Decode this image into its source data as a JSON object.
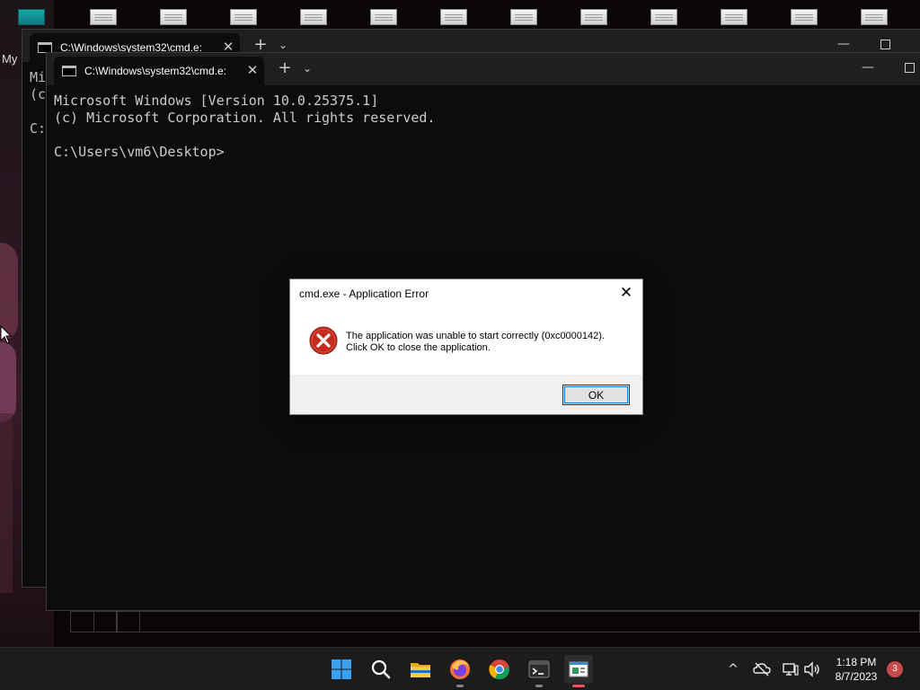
{
  "desktop": {
    "label_partial": "My"
  },
  "back_window": {
    "tab_title": "C:\\Windows\\system32\\cmd.e:",
    "console_lines": [
      "Mi",
      "(c",
      "",
      "C:"
    ],
    "close_glyph": "✕",
    "new_tab_glyph": "+",
    "dropdown_glyph": "⌄",
    "minimize_glyph": "—"
  },
  "front_window": {
    "tab_title": "C:\\Windows\\system32\\cmd.e:",
    "console_text": "Microsoft Windows [Version 10.0.25375.1]\n(c) Microsoft Corporation. All rights reserved.\n\nC:\\Users\\vm6\\Desktop>",
    "close_glyph": "✕",
    "new_tab_glyph": "+",
    "dropdown_glyph": "⌄",
    "minimize_glyph": "—"
  },
  "dialog": {
    "title": "cmd.exe - Application Error",
    "close_glyph": "✕",
    "message_line1": "The application was unable to start correctly (0xc0000142).",
    "message_line2": "Click OK to close the application.",
    "ok_label": "OK",
    "error_color": "#c42b1c"
  },
  "taskbar": {
    "items": [
      {
        "name": "start-button",
        "icon": "windows-logo-icon"
      },
      {
        "name": "search-button",
        "icon": "search-icon"
      },
      {
        "name": "file-explorer",
        "icon": "folder-icon"
      },
      {
        "name": "firefox",
        "icon": "firefox-icon"
      },
      {
        "name": "chrome",
        "icon": "chrome-icon"
      },
      {
        "name": "terminal",
        "icon": "terminal-icon"
      },
      {
        "name": "cmd-error-window",
        "icon": "app-window-icon",
        "active": true
      }
    ],
    "tray": {
      "chevron_glyph": "^",
      "clock_time": "1:18 PM",
      "clock_date": "8/7/2023",
      "notification_count": "3"
    }
  }
}
